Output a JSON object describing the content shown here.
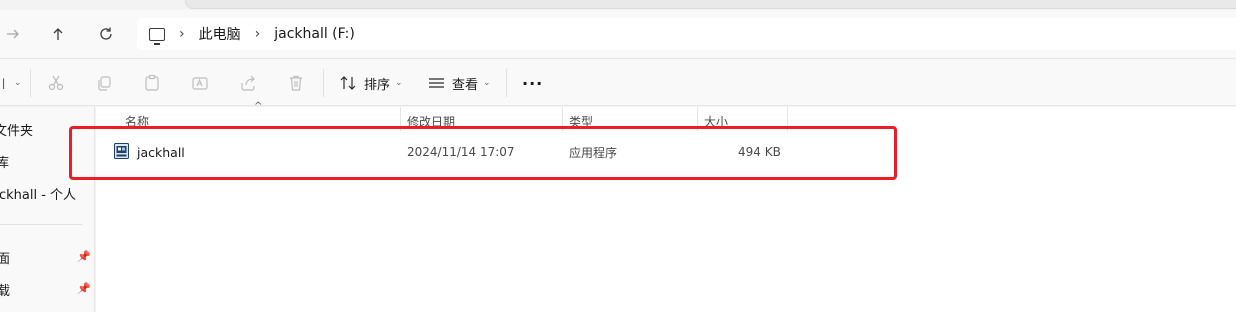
{
  "tabbar": {
    "ghost_text": "—"
  },
  "nav": {
    "forward_icon": "arrow-right-icon",
    "up_icon": "arrow-up-icon",
    "refresh_icon": "refresh-icon"
  },
  "address": {
    "root_icon": "computer-icon",
    "crumbs": [
      "此电脑",
      "jackhall (F:)"
    ]
  },
  "toolbar": {
    "sort_label": "排序",
    "view_label": "查看",
    "more_label": "···",
    "icons": [
      "cut-icon",
      "copy-icon",
      "paste-icon",
      "rename-icon",
      "share-icon",
      "delete-icon"
    ]
  },
  "sidebar": {
    "items": [
      {
        "label": "文件夹",
        "partial_prefix": "文"
      },
      {
        "label": "库"
      },
      {
        "label": "ckhall - 个人"
      },
      {
        "label": "面",
        "pinned": true
      },
      {
        "label": "载",
        "pinned": true
      }
    ]
  },
  "table": {
    "headers": {
      "name": "名称",
      "date": "修改日期",
      "type": "类型",
      "size": "大小"
    },
    "rows": [
      {
        "name": "jackhall",
        "date": "2024/11/14 17:07",
        "type": "应用程序",
        "size": "494 KB",
        "icon": "application-icon"
      }
    ]
  },
  "colors": {
    "highlight": "#ee1c25",
    "background": "#f3f3f3",
    "content": "#ffffff"
  }
}
